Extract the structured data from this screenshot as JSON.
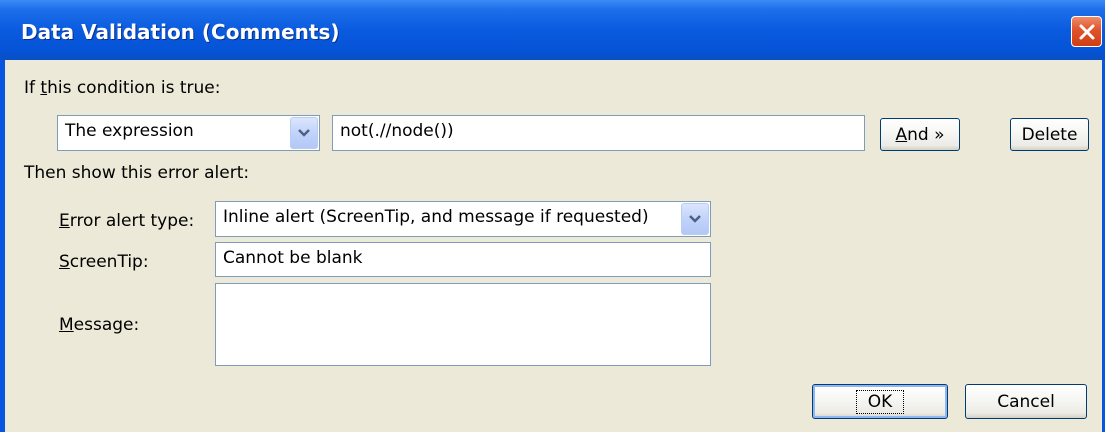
{
  "window": {
    "title": "Data Validation (Comments)"
  },
  "condition": {
    "heading": "If this condition is true:",
    "operand_select": "The expression",
    "expression_value": "not(.//node())",
    "and_button": "And »",
    "delete_button": "Delete"
  },
  "error_alert": {
    "heading": "Then show this error alert:",
    "type_label": "Error alert type:",
    "type_value": "Inline alert (ScreenTip, and message if requested)",
    "screentip_label": "ScreenTip:",
    "screentip_value": "Cannot be blank",
    "message_label": "Message:",
    "message_value": ""
  },
  "buttons": {
    "ok": "OK",
    "cancel": "Cancel"
  },
  "colors": {
    "titlebar": "#0a5bdf",
    "client_bg": "#ece9d8",
    "field_border": "#7f9db9",
    "close_button": "#e0532a"
  }
}
